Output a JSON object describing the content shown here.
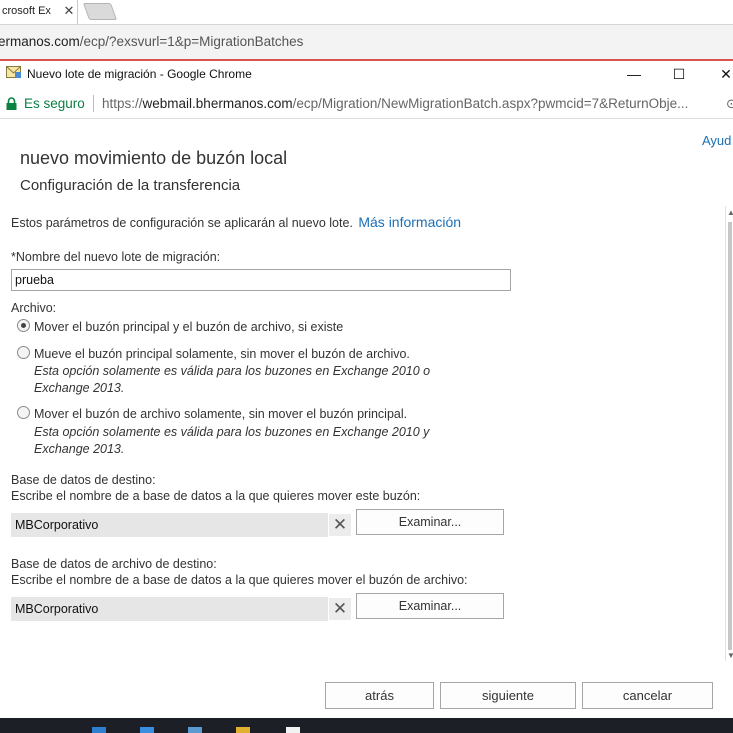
{
  "background_window": {
    "tab_title": "crosoft Ex",
    "url_host": "ermanos.com",
    "url_path": "/ecp/?exsvurl=1&p=MigrationBatches"
  },
  "popup": {
    "window_title": "Nuevo lote de migración - Google Chrome",
    "secure_label": "Es seguro",
    "url_scheme": "https://",
    "url_host": "webmail.bhermanos.com",
    "url_path": "/ecp/Migration/NewMigrationBatch.aspx?pwmcid=7&ReturnObje..."
  },
  "dialog": {
    "help_label": "Ayud",
    "title": "nuevo movimiento de buzón local",
    "subtitle": "Configuración de la transferencia",
    "intro_text": "Estos parámetros de configuración se aplicarán al nuevo lote.",
    "more_info_link": "Más información",
    "batch_name_label": "*Nombre del nuevo lote de migración:",
    "batch_name_value": "prueba",
    "archive_label": "Archivo:",
    "archive_options": [
      {
        "label": "Mover el buzón principal y el buzón de archivo, si existe",
        "note": "",
        "selected": true
      },
      {
        "label": "Mueve el buzón principal solamente, sin mover el buzón de archivo.",
        "note": "Esta opción solamente es válida para los buzones en Exchange 2010 o Exchange 2013.",
        "selected": false
      },
      {
        "label": "Mover el buzón de archivo solamente, sin mover el buzón principal.",
        "note": "Esta opción solamente es válida para los buzones en Exchange 2010 y Exchange 2013.",
        "selected": false
      }
    ],
    "target_db": {
      "label": "Base de datos de destino:",
      "description": "Escribe el nombre de a base de datos a la que quieres mover este buzón:",
      "value": "MBCorporativo",
      "browse_label": "Examinar..."
    },
    "target_archive_db": {
      "label": "Base de datos de archivo de destino:",
      "description": "Escribe el nombre de a base de datos a la que quieres mover el buzón de archivo:",
      "value": "MBCorporativo",
      "browse_label": "Examinar..."
    },
    "footer": {
      "back_label": "atrás",
      "next_label": "siguiente",
      "cancel_label": "cancelar"
    }
  },
  "colors": {
    "accent_link": "#1a6fb5",
    "secure_green": "#0b8043",
    "popup_border": "#d9534f",
    "field_fill": "#e6e6e6"
  }
}
